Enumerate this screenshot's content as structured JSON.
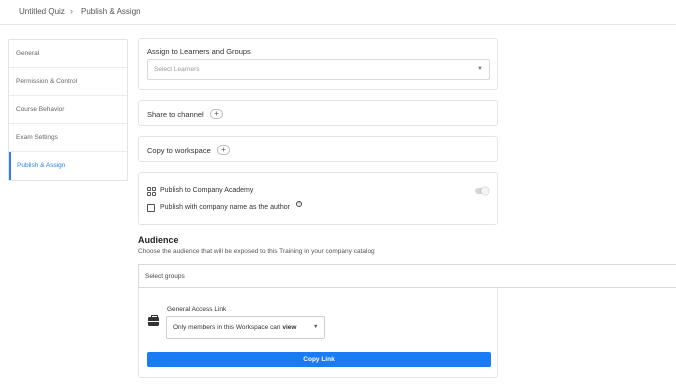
{
  "breadcrumb": {
    "quiz": "Untitled Quiz",
    "separator": "›",
    "current": "Publish & Assign"
  },
  "sidebar": {
    "items": [
      {
        "label": "General"
      },
      {
        "label": "Permission & Control"
      },
      {
        "label": "Course Behavior"
      },
      {
        "label": "Exam Settings"
      },
      {
        "label": "Publish & Assign",
        "active": true
      }
    ]
  },
  "assign": {
    "title": "Assign to Learners and Groups",
    "placeholder": "Select Learners"
  },
  "share": {
    "label": "Share to channel",
    "button": "+"
  },
  "copy_workspace": {
    "label": "Copy to workspace",
    "button": "+"
  },
  "academy": {
    "publish_label": "Publish to Company Academy",
    "author_label": "Publish with company name as the author",
    "info_glyph": "?",
    "toggle_on": false,
    "author_checked": false
  },
  "audience": {
    "title": "Audience",
    "description": "Choose the audience that will be exposed to this Training in your company catalog",
    "groups_placeholder": "Select groups"
  },
  "access": {
    "label": "General Access Link",
    "permission_prefix": "Only members in this Workspace can ",
    "permission_value": "view",
    "copy_button": "Copy Link"
  },
  "icons": {
    "breadcrumb_separator": "chevron-right-icon",
    "dropdown": "caret-down-icon",
    "academy": "grid-apps-icon",
    "access": "briefcase-icon",
    "info": "info-icon"
  },
  "colors": {
    "accent": "#2f80ed",
    "button": "#1a7cf5"
  }
}
